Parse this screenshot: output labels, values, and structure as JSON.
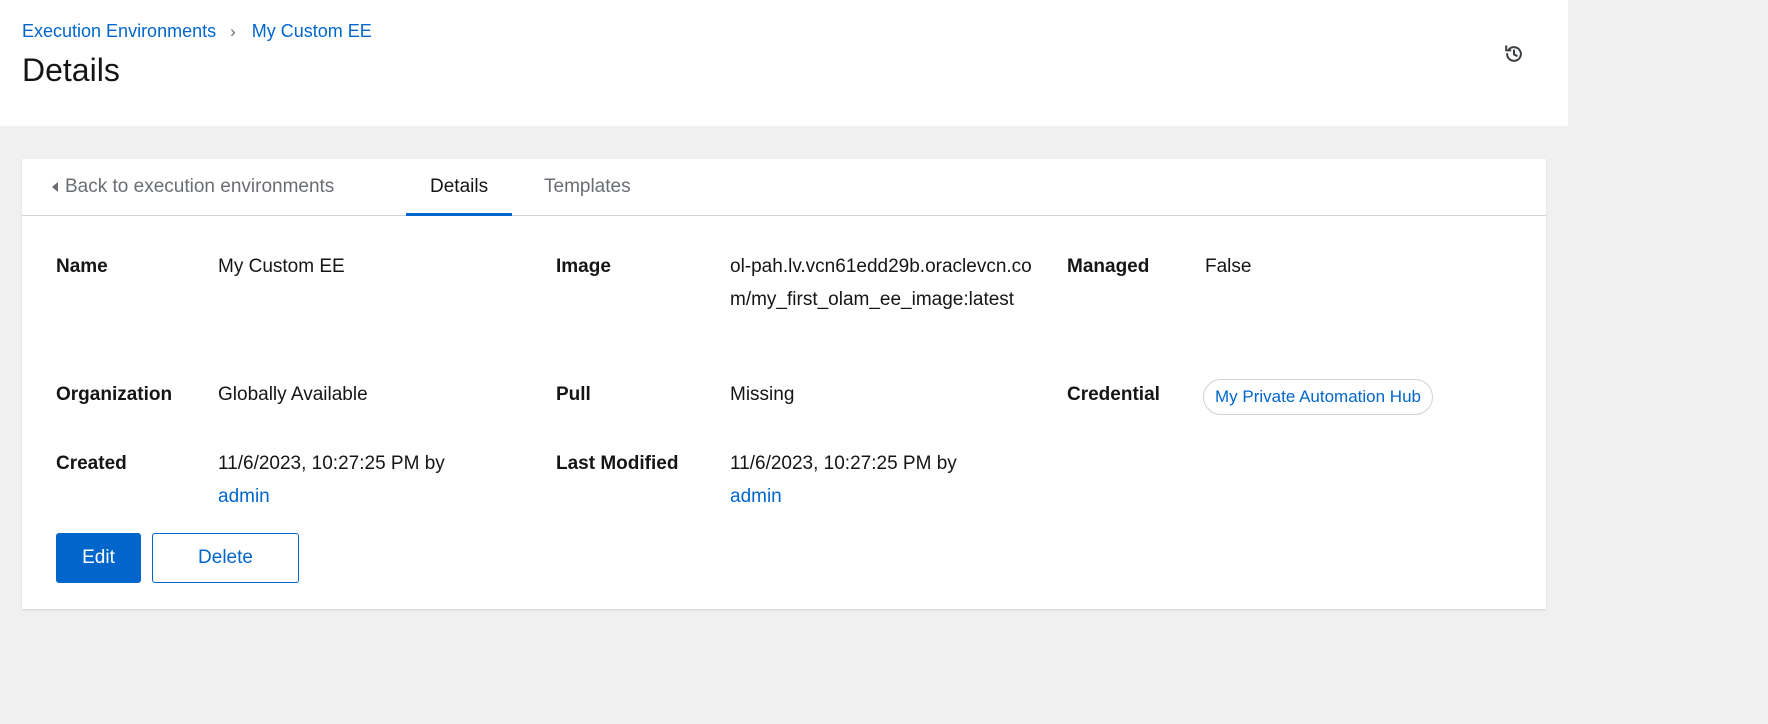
{
  "breadcrumb": {
    "parent": "Execution Environments",
    "current": "My Custom EE"
  },
  "page": {
    "title": "Details",
    "history_icon": "history-icon"
  },
  "tabs": {
    "back": "Back to execution environments",
    "details": "Details",
    "templates": "Templates"
  },
  "details": {
    "name_label": "Name",
    "name_value": "My Custom EE",
    "image_label": "Image",
    "image_value": "ol-pah.lv.vcn61edd29b.oraclevcn.com/my_first_olam_ee_image:latest",
    "managed_label": "Managed",
    "managed_value": "False",
    "organization_label": "Organization",
    "organization_value": "Globally Available",
    "pull_label": "Pull",
    "pull_value": "Missing",
    "credential_label": "Credential",
    "credential_value": "My Private Automation Hub",
    "created_label": "Created",
    "created_value": "11/6/2023, 10:27:25 PM by",
    "created_by": "admin",
    "modified_label": "Last Modified",
    "modified_value": "11/6/2023, 10:27:25 PM by",
    "modified_by": "admin"
  },
  "actions": {
    "edit": "Edit",
    "delete": "Delete"
  },
  "colors": {
    "accent": "#0066cc",
    "page_bg": "#f0f0f0"
  }
}
